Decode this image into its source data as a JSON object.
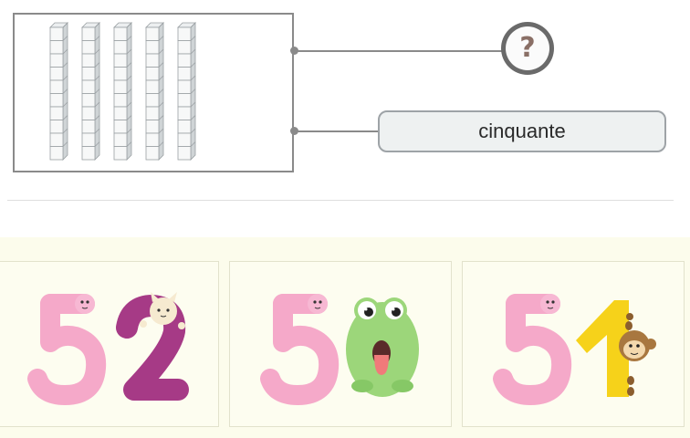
{
  "question": {
    "block_columns": 5,
    "cubes_per_column": 10,
    "unknown_symbol": "?",
    "given_word": "cinquante"
  },
  "choices": [
    {
      "name": "choice-52",
      "value": "52"
    },
    {
      "name": "choice-50",
      "value": "50"
    },
    {
      "name": "choice-51",
      "value": "51"
    }
  ],
  "colors": {
    "worm_pink": "#f5a9c9",
    "two_purple": "#a63a86",
    "frog_green": "#9cd67a",
    "one_yellow": "#f6d21a",
    "frame_gray": "#8a8a8a"
  }
}
